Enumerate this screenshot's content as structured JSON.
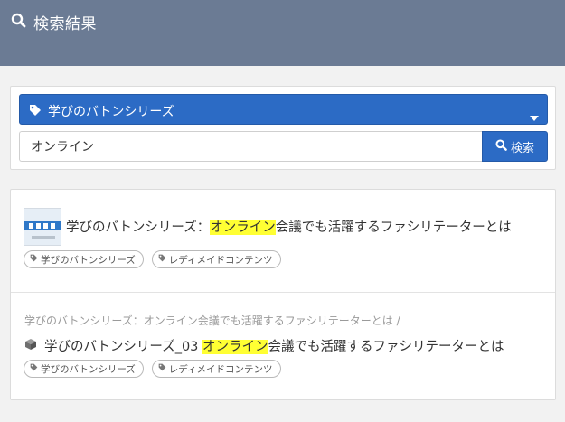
{
  "header": {
    "title": "検索結果",
    "bg_color": "#6b7b94",
    "icon": "search-icon"
  },
  "search": {
    "category": "学びのバトンシリーズ",
    "category_icon": "tag-icon",
    "input_value": "オンライン",
    "button_label": "検索",
    "accent_color": "#2c6bc5"
  },
  "results": [
    {
      "title_before": "学びのバトンシリーズ：",
      "title_highlight": "オンライン",
      "title_after": "会議でも活躍するファシリテーターとは",
      "tags": [
        "学びのバトンシリーズ",
        "レディメイドコンテンツ"
      ]
    },
    {
      "breadcrumb": "学びのバトンシリーズ：オンライン会議でも活躍するファシリテーターとは /",
      "title_before": "学びのバトンシリーズ_03 ",
      "title_highlight": "オンライン",
      "title_after": "会議でも活躍するファシリテーターとは",
      "tags": [
        "学びのバトンシリーズ",
        "レディメイドコンテンツ"
      ]
    }
  ],
  "highlight_color": "#ffff33"
}
